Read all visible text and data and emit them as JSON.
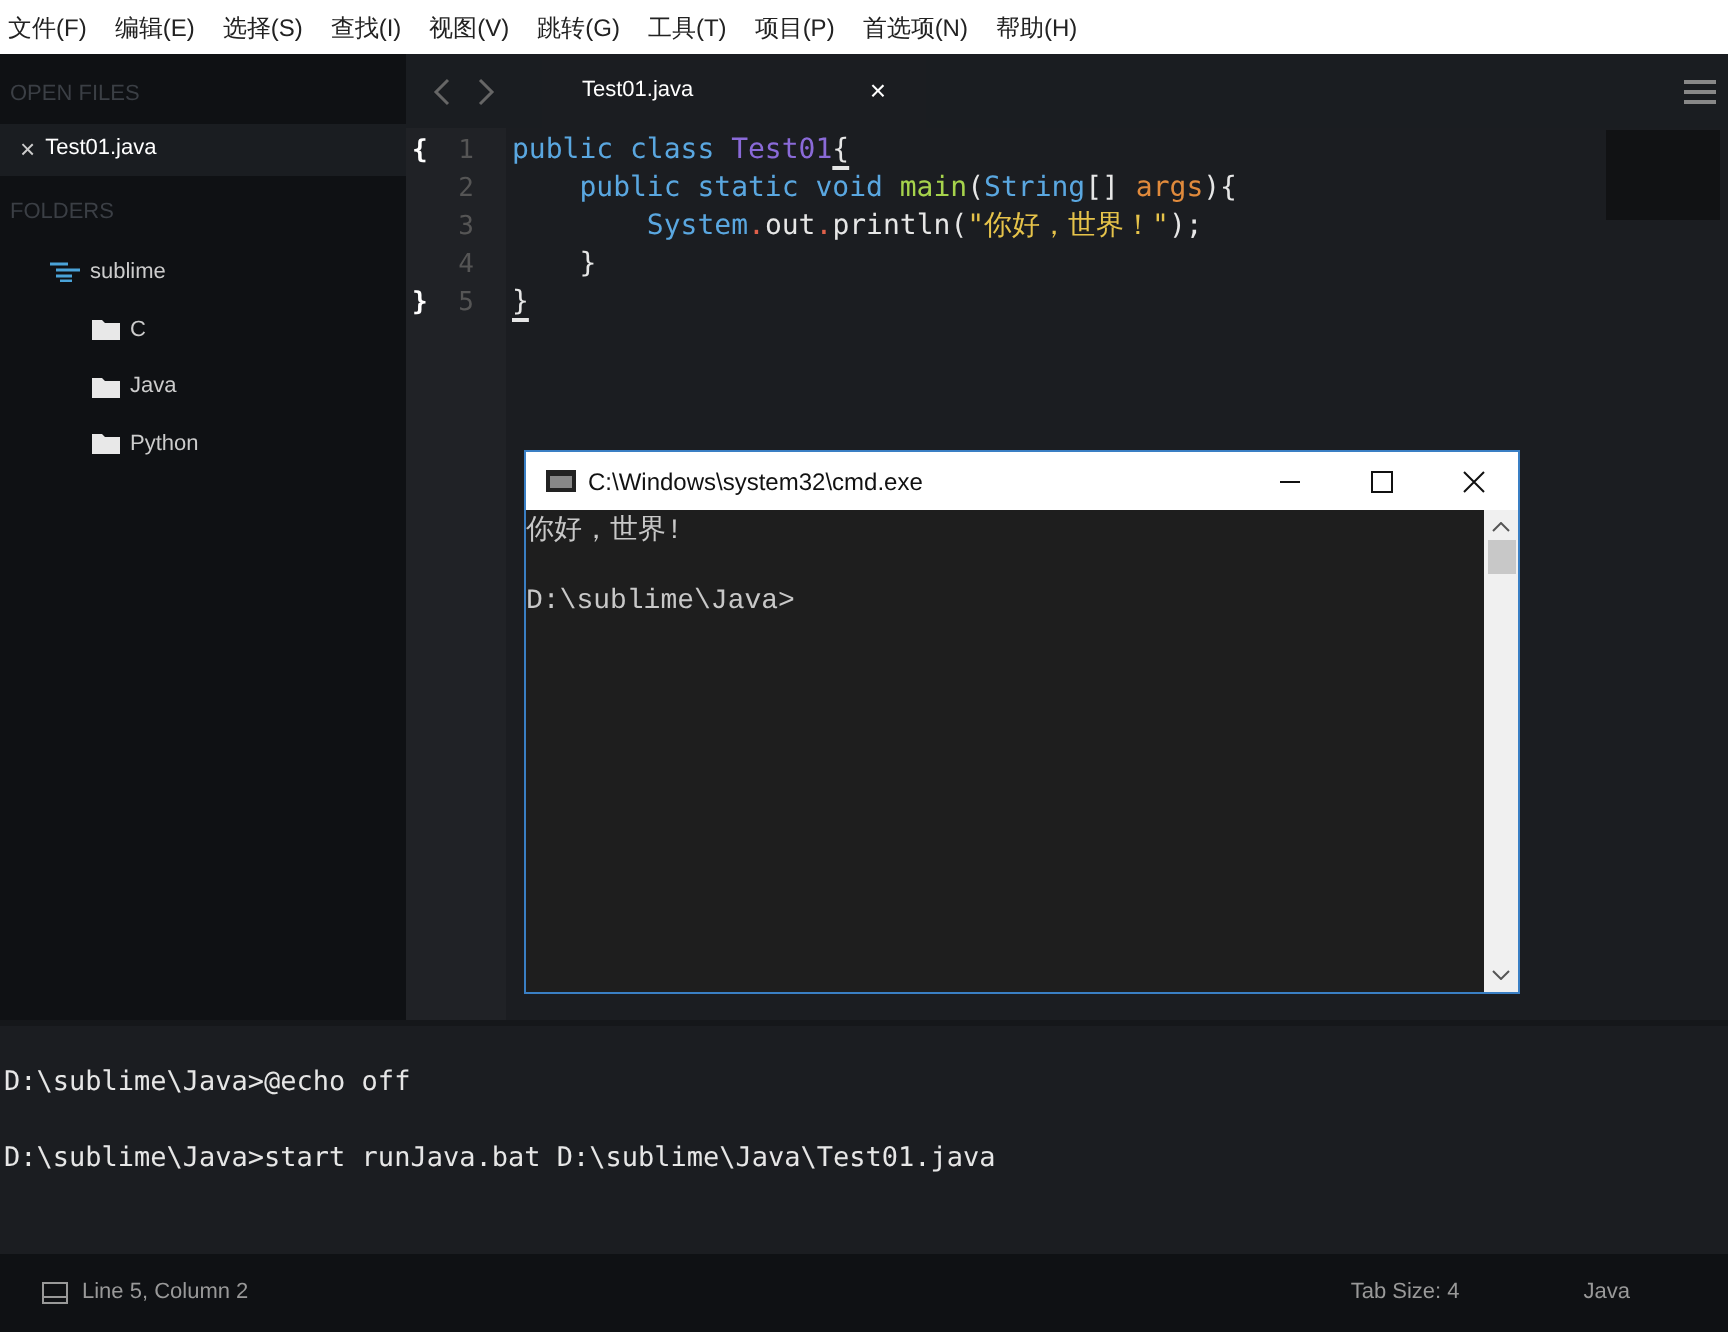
{
  "menu": [
    "文件(F)",
    "编辑(E)",
    "选择(S)",
    "查找(I)",
    "视图(V)",
    "跳转(G)",
    "工具(T)",
    "项目(P)",
    "首选项(N)",
    "帮助(H)"
  ],
  "sidebar": {
    "open_files_heading": "OPEN FILES",
    "open_files": [
      {
        "name": "Test01.java",
        "close": "×",
        "selected": true
      }
    ],
    "folders_heading": "FOLDERS",
    "folders": [
      {
        "name": "sublime",
        "children": [
          {
            "name": "C"
          },
          {
            "name": "Java"
          },
          {
            "name": "Python"
          }
        ]
      }
    ]
  },
  "tabs": [
    {
      "label": "Test01.java",
      "close": "×",
      "selected": true
    }
  ],
  "editor": {
    "lines": [
      {
        "number": "1",
        "fold": "{",
        "tokens": [
          {
            "text": "public class ",
            "kind": "keyword"
          },
          {
            "text": "Test01",
            "kind": "type"
          },
          {
            "text": "{",
            "kind": "cursor"
          }
        ]
      },
      {
        "number": "2",
        "tokens": [
          {
            "text": "    public static void ",
            "kind": "keyword"
          },
          {
            "text": "main",
            "kind": "function"
          },
          {
            "text": "(",
            "kind": "plain"
          },
          {
            "text": "String",
            "kind": "keyword"
          },
          {
            "text": "[] ",
            "kind": "plain"
          },
          {
            "text": "args",
            "kind": "param"
          },
          {
            "text": "){",
            "kind": "plain"
          }
        ]
      },
      {
        "number": "3",
        "tokens": [
          {
            "text": "        System",
            "kind": "keyword"
          },
          {
            "text": ".",
            "kind": "operator"
          },
          {
            "text": "out",
            "kind": "plain"
          },
          {
            "text": ".",
            "kind": "operator"
          },
          {
            "text": "println(",
            "kind": "plain"
          },
          {
            "text": "\"你好，世界！\"",
            "kind": "string"
          },
          {
            "text": ");",
            "kind": "plain"
          }
        ]
      },
      {
        "number": "4",
        "tokens": [
          {
            "text": "    }",
            "kind": "plain"
          }
        ]
      },
      {
        "number": "5",
        "fold": "}",
        "tokens": [
          {
            "text": "}",
            "kind": "cursor"
          }
        ]
      }
    ]
  },
  "cmd_window": {
    "title": "C:\\Windows\\system32\\cmd.exe",
    "lines": [
      "你好，世界!",
      "D:\\sublime\\Java>"
    ]
  },
  "output_panel": {
    "lines": [
      "D:\\sublime\\Java>@echo off",
      "D:\\sublime\\Java>start runJava.bat D:\\sublime\\Java\\Test01.java"
    ]
  },
  "status_bar": {
    "position": "Line 5, Column 2",
    "tab_size": "Tab Size: 4",
    "syntax": "Java"
  }
}
